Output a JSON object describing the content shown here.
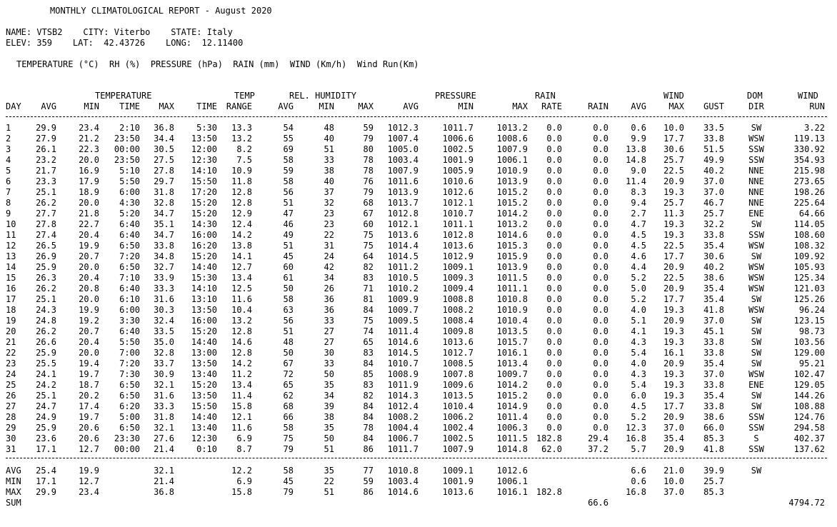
{
  "header": {
    "title": "MONTHLY CLIMATOLOGICAL REPORT - August 2020",
    "location_line1": "NAME: VTSB2    CITY: Viterbo    STATE: Italy",
    "location_line2": "ELEV: 359    LAT:  42.43726    LONG:  12.11400",
    "units_line": "TEMPERATURE (°C)  RH (%)  PRESSURE (hPa)  RAIN (mm)  WIND (Km/h)  Wind Run(Km)"
  },
  "group_headers": {
    "temperature": "TEMPERATURE",
    "temp": "TEMP",
    "rel_humidity": "REL. HUMIDITY",
    "pressure": "PRESSURE",
    "rain": "RAIN",
    "wind": "WIND",
    "dom": "DOM",
    "wind2": "WIND"
  },
  "columns": [
    "DAY",
    "AVG",
    "MIN",
    "TIME",
    "MAX",
    "TIME",
    "RANGE",
    "AVG",
    "MIN",
    "MAX",
    "AVG",
    "MIN",
    "MAX",
    "RATE",
    "RAIN",
    "AVG",
    "MAX",
    "GUST",
    "DIR",
    "RUN"
  ],
  "rows": [
    [
      "1",
      "29.9",
      "23.4",
      "2:10",
      "36.8",
      "5:30",
      "13.3",
      "54",
      "48",
      "59",
      "1012.3",
      "1011.7",
      "1013.2",
      "0.0",
      "0.0",
      "0.6",
      "10.0",
      "33.5",
      "SW",
      "3.22"
    ],
    [
      "2",
      "27.9",
      "21.2",
      "23:50",
      "34.4",
      "13:50",
      "13.2",
      "55",
      "40",
      "79",
      "1007.4",
      "1006.6",
      "1008.6",
      "0.0",
      "0.0",
      "9.9",
      "17.7",
      "33.8",
      "WSW",
      "119.13"
    ],
    [
      "3",
      "26.1",
      "22.3",
      "00:00",
      "30.5",
      "12:00",
      "8.2",
      "69",
      "51",
      "80",
      "1005.0",
      "1002.5",
      "1007.9",
      "0.0",
      "0.0",
      "13.8",
      "30.6",
      "51.5",
      "SSW",
      "330.92"
    ],
    [
      "4",
      "23.2",
      "20.0",
      "23:50",
      "27.5",
      "12:30",
      "7.5",
      "58",
      "33",
      "78",
      "1003.4",
      "1001.9",
      "1006.1",
      "0.0",
      "0.0",
      "14.8",
      "25.7",
      "49.9",
      "SSW",
      "354.93"
    ],
    [
      "5",
      "21.7",
      "16.9",
      "5:10",
      "27.8",
      "14:10",
      "10.9",
      "59",
      "38",
      "78",
      "1007.9",
      "1005.9",
      "1010.9",
      "0.0",
      "0.0",
      "9.0",
      "22.5",
      "40.2",
      "NNE",
      "215.98"
    ],
    [
      "6",
      "23.3",
      "17.9",
      "5:50",
      "29.7",
      "15:50",
      "11.8",
      "58",
      "40",
      "76",
      "1011.6",
      "1010.6",
      "1013.9",
      "0.0",
      "0.0",
      "11.4",
      "20.9",
      "37.0",
      "NNE",
      "273.65"
    ],
    [
      "7",
      "25.1",
      "18.9",
      "6:00",
      "31.8",
      "17:20",
      "12.8",
      "56",
      "37",
      "79",
      "1013.9",
      "1012.6",
      "1015.2",
      "0.0",
      "0.0",
      "8.3",
      "19.3",
      "37.0",
      "NNE",
      "198.26"
    ],
    [
      "8",
      "26.2",
      "20.0",
      "4:30",
      "32.8",
      "15:20",
      "12.8",
      "51",
      "32",
      "68",
      "1013.7",
      "1012.1",
      "1015.2",
      "0.0",
      "0.0",
      "9.4",
      "25.7",
      "46.7",
      "NNE",
      "225.64"
    ],
    [
      "9",
      "27.7",
      "21.8",
      "5:20",
      "34.7",
      "15:20",
      "12.9",
      "47",
      "23",
      "67",
      "1012.8",
      "1010.7",
      "1014.2",
      "0.0",
      "0.0",
      "2.7",
      "11.3",
      "25.7",
      "ENE",
      "64.66"
    ],
    [
      "10",
      "27.8",
      "22.7",
      "6:40",
      "35.1",
      "14:30",
      "12.4",
      "46",
      "23",
      "60",
      "1012.1",
      "1011.1",
      "1013.2",
      "0.0",
      "0.0",
      "4.7",
      "19.3",
      "32.2",
      "SW",
      "114.05"
    ],
    [
      "11",
      "27.4",
      "20.4",
      "6:40",
      "34.7",
      "16:00",
      "14.2",
      "49",
      "22",
      "75",
      "1013.6",
      "1012.8",
      "1014.6",
      "0.0",
      "0.0",
      "4.5",
      "19.3",
      "33.8",
      "SSW",
      "108.60"
    ],
    [
      "12",
      "26.5",
      "19.9",
      "6:50",
      "33.8",
      "16:20",
      "13.8",
      "51",
      "31",
      "75",
      "1014.4",
      "1013.6",
      "1015.3",
      "0.0",
      "0.0",
      "4.5",
      "22.5",
      "35.4",
      "WSW",
      "108.32"
    ],
    [
      "13",
      "26.9",
      "20.7",
      "7:20",
      "34.8",
      "15:20",
      "14.1",
      "45",
      "24",
      "64",
      "1014.5",
      "1012.9",
      "1015.9",
      "0.0",
      "0.0",
      "4.6",
      "17.7",
      "30.6",
      "SW",
      "109.92"
    ],
    [
      "14",
      "25.9",
      "20.0",
      "6:50",
      "32.7",
      "14:40",
      "12.7",
      "60",
      "42",
      "82",
      "1011.2",
      "1009.1",
      "1013.9",
      "0.0",
      "0.0",
      "4.4",
      "20.9",
      "40.2",
      "WSW",
      "105.93"
    ],
    [
      "15",
      "26.3",
      "20.4",
      "7:10",
      "33.9",
      "15:30",
      "13.4",
      "61",
      "34",
      "83",
      "1010.5",
      "1009.3",
      "1011.5",
      "0.0",
      "0.0",
      "5.2",
      "22.5",
      "38.6",
      "WSW",
      "125.34"
    ],
    [
      "16",
      "26.2",
      "20.8",
      "6:40",
      "33.3",
      "14:10",
      "12.5",
      "50",
      "26",
      "71",
      "1010.2",
      "1009.4",
      "1011.1",
      "0.0",
      "0.0",
      "5.0",
      "20.9",
      "35.4",
      "WSW",
      "121.03"
    ],
    [
      "17",
      "25.1",
      "20.0",
      "6:10",
      "31.6",
      "13:10",
      "11.6",
      "58",
      "36",
      "81",
      "1009.9",
      "1008.8",
      "1010.8",
      "0.0",
      "0.0",
      "5.2",
      "17.7",
      "35.4",
      "SW",
      "125.26"
    ],
    [
      "18",
      "24.3",
      "19.9",
      "6:00",
      "30.3",
      "13:50",
      "10.4",
      "63",
      "36",
      "84",
      "1009.7",
      "1008.2",
      "1010.9",
      "0.0",
      "0.0",
      "4.0",
      "19.3",
      "41.8",
      "WSW",
      "96.24"
    ],
    [
      "19",
      "24.8",
      "19.2",
      "3:30",
      "32.4",
      "16:00",
      "13.2",
      "56",
      "33",
      "75",
      "1009.5",
      "1008.4",
      "1010.4",
      "0.0",
      "0.0",
      "5.1",
      "20.9",
      "37.0",
      "SW",
      "123.15"
    ],
    [
      "20",
      "26.2",
      "20.7",
      "6:40",
      "33.5",
      "15:20",
      "12.8",
      "51",
      "27",
      "74",
      "1011.4",
      "1009.8",
      "1013.5",
      "0.0",
      "0.0",
      "4.1",
      "19.3",
      "45.1",
      "SW",
      "98.73"
    ],
    [
      "21",
      "26.6",
      "20.4",
      "5:50",
      "35.0",
      "14:40",
      "14.6",
      "48",
      "27",
      "65",
      "1014.6",
      "1013.6",
      "1015.7",
      "0.0",
      "0.0",
      "4.3",
      "19.3",
      "33.8",
      "SW",
      "103.56"
    ],
    [
      "22",
      "25.9",
      "20.0",
      "7:00",
      "32.8",
      "13:00",
      "12.8",
      "50",
      "30",
      "83",
      "1014.5",
      "1012.7",
      "1016.1",
      "0.0",
      "0.0",
      "5.4",
      "16.1",
      "33.8",
      "SW",
      "129.00"
    ],
    [
      "23",
      "25.5",
      "19.4",
      "7:20",
      "33.7",
      "13:50",
      "14.2",
      "67",
      "33",
      "84",
      "1010.7",
      "1008.5",
      "1013.4",
      "0.0",
      "0.0",
      "4.0",
      "20.9",
      "35.4",
      "SW",
      "95.21"
    ],
    [
      "24",
      "24.1",
      "19.7",
      "7:30",
      "30.9",
      "13:40",
      "11.2",
      "72",
      "50",
      "85",
      "1008.9",
      "1007.8",
      "1009.7",
      "0.0",
      "0.0",
      "4.3",
      "19.3",
      "37.0",
      "WSW",
      "102.47"
    ],
    [
      "25",
      "24.2",
      "18.7",
      "6:50",
      "32.1",
      "15:20",
      "13.4",
      "65",
      "35",
      "83",
      "1011.9",
      "1009.6",
      "1014.2",
      "0.0",
      "0.0",
      "5.4",
      "19.3",
      "33.8",
      "ENE",
      "129.05"
    ],
    [
      "26",
      "25.1",
      "20.2",
      "6:50",
      "31.6",
      "13:50",
      "11.4",
      "62",
      "34",
      "82",
      "1014.3",
      "1013.5",
      "1015.2",
      "0.0",
      "0.0",
      "6.0",
      "19.3",
      "35.4",
      "SW",
      "144.26"
    ],
    [
      "27",
      "24.7",
      "17.4",
      "6:20",
      "33.3",
      "15:50",
      "15.8",
      "68",
      "39",
      "84",
      "1012.4",
      "1010.4",
      "1014.9",
      "0.0",
      "0.0",
      "4.5",
      "17.7",
      "33.8",
      "SW",
      "108.88"
    ],
    [
      "28",
      "24.9",
      "19.7",
      "5:00",
      "31.8",
      "14:40",
      "12.1",
      "66",
      "38",
      "84",
      "1008.2",
      "1006.2",
      "1011.4",
      "0.0",
      "0.0",
      "5.2",
      "20.9",
      "38.6",
      "SSW",
      "124.76"
    ],
    [
      "29",
      "25.9",
      "20.6",
      "6:50",
      "32.1",
      "13:40",
      "11.6",
      "58",
      "35",
      "78",
      "1004.4",
      "1002.4",
      "1006.3",
      "0.0",
      "0.0",
      "12.3",
      "37.0",
      "66.0",
      "SSW",
      "294.58"
    ],
    [
      "30",
      "23.6",
      "20.6",
      "23:30",
      "27.6",
      "12:30",
      "6.9",
      "75",
      "50",
      "84",
      "1006.7",
      "1002.5",
      "1011.5",
      "182.8",
      "29.4",
      "16.8",
      "35.4",
      "85.3",
      "S",
      "402.37"
    ],
    [
      "31",
      "17.1",
      "12.7",
      "00:00",
      "21.4",
      "0:10",
      "8.7",
      "79",
      "51",
      "86",
      "1011.7",
      "1007.9",
      "1014.8",
      "62.0",
      "37.2",
      "5.7",
      "20.9",
      "41.8",
      "SSW",
      "137.62"
    ]
  ],
  "summary": [
    [
      "AVG",
      "25.4",
      "19.9",
      "",
      "32.1",
      "",
      "12.2",
      "58",
      "35",
      "77",
      "1010.8",
      "1009.1",
      "1012.6",
      "",
      "",
      "6.6",
      "21.0",
      "39.9",
      "SW",
      ""
    ],
    [
      "MIN",
      "17.1",
      "12.7",
      "",
      "21.4",
      "",
      "6.9",
      "45",
      "22",
      "59",
      "1003.4",
      "1001.9",
      "1006.1",
      "",
      "",
      "0.6",
      "10.0",
      "25.7",
      "",
      ""
    ],
    [
      "MAX",
      "29.9",
      "23.4",
      "",
      "36.8",
      "",
      "15.8",
      "79",
      "51",
      "86",
      "1014.6",
      "1013.6",
      "1016.1",
      "182.8",
      "",
      "16.8",
      "37.0",
      "85.3",
      "",
      ""
    ],
    [
      "SUM",
      "",
      "",
      "",
      "",
      "",
      "",
      "",
      "",
      "",
      "",
      "",
      "",
      "",
      "66.6",
      "",
      "",
      "",
      "",
      "4794.72"
    ]
  ]
}
